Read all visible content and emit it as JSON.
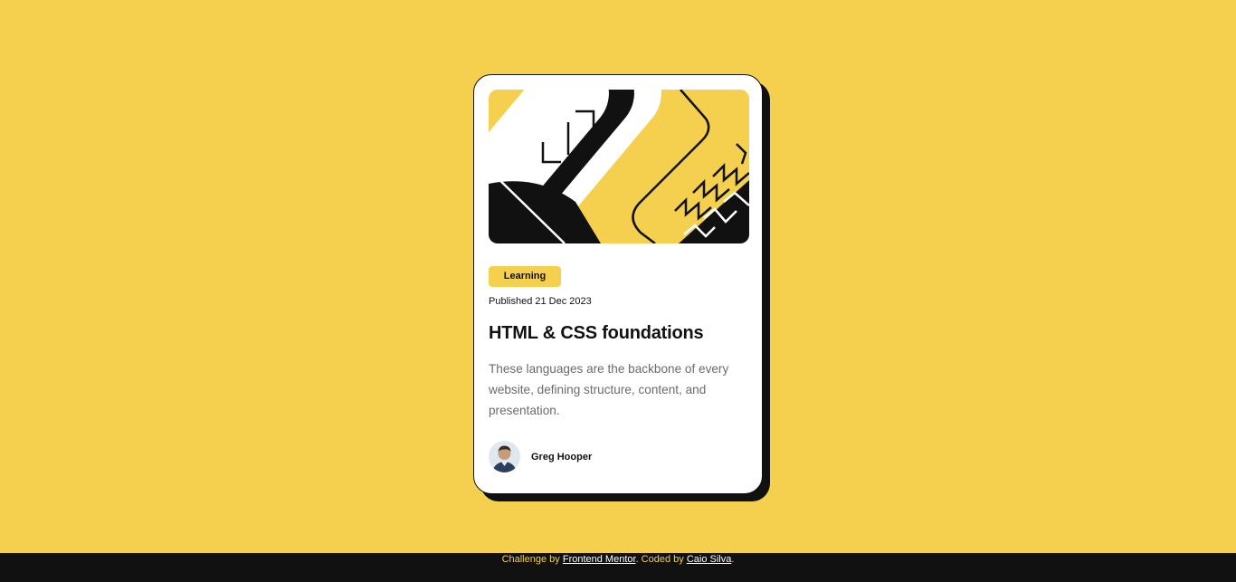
{
  "colors": {
    "background": "#f4d04e",
    "card": "#ffffff",
    "ink": "#111111",
    "muted": "#6b6b6b"
  },
  "card": {
    "hero_image": "abstract-illustration",
    "tag": "Learning",
    "published": "Published 21 Dec 2023",
    "title": "HTML & CSS foundations",
    "description": "These languages are the backbone of every website, defining structure, content, and presentation.",
    "author": {
      "avatar": "author-avatar",
      "name": "Greg Hooper"
    }
  },
  "footer": {
    "prefix": "Challenge by ",
    "challenge_link": "Frontend Mentor",
    "middle": ". Coded by ",
    "coder_link": "Caio Silva",
    "suffix": "."
  }
}
